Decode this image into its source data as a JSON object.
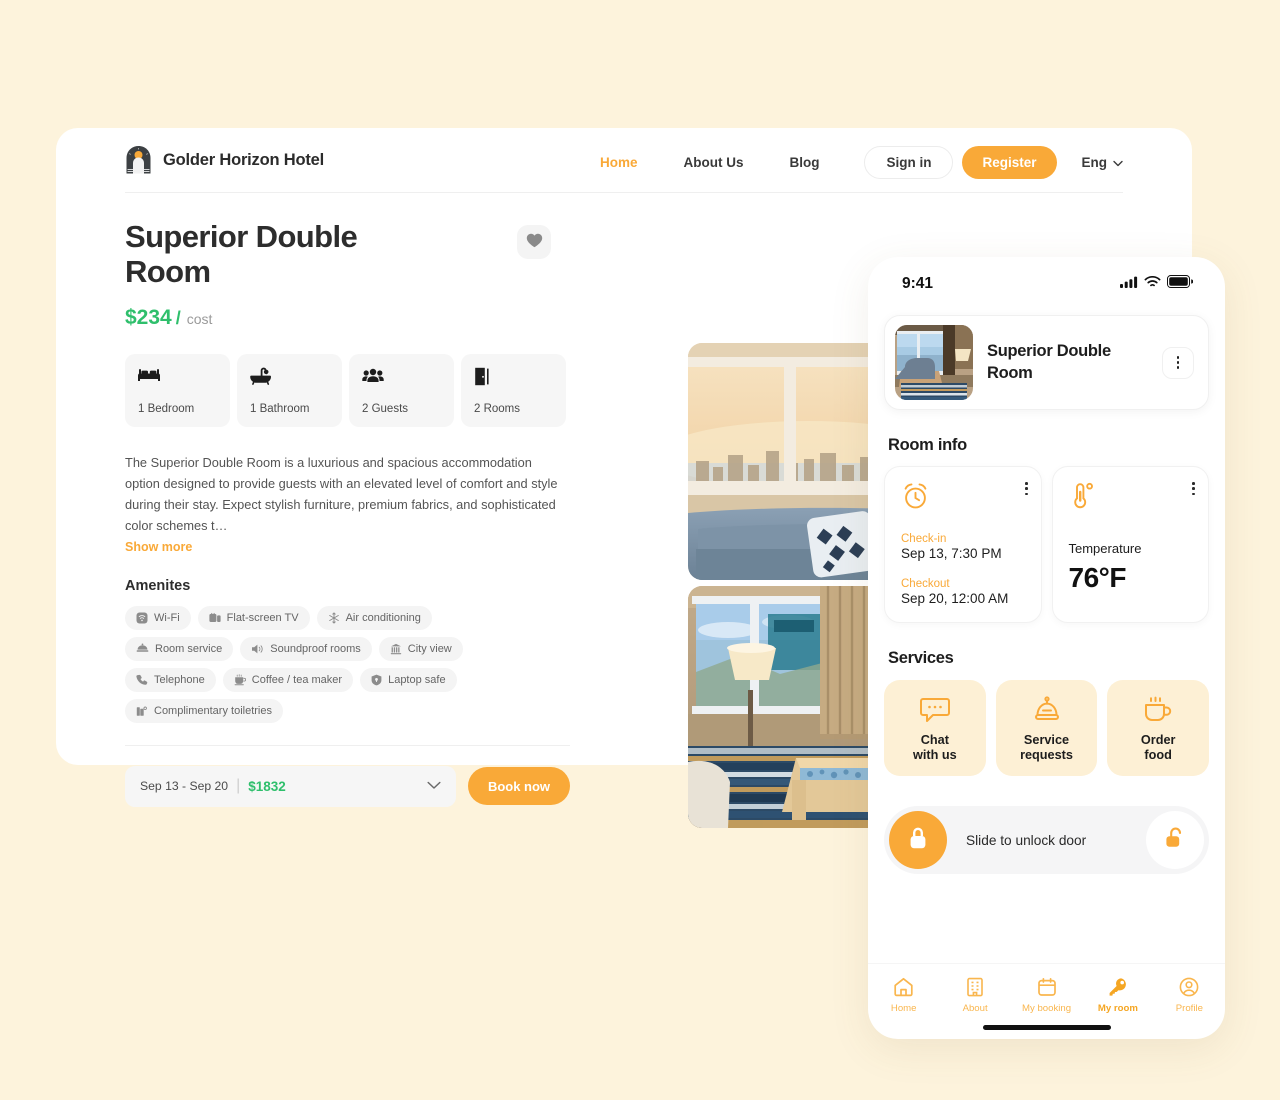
{
  "theme": {
    "page_bg": "#fdf3dc",
    "accent": "#f9a938",
    "green": "#2fbf6c",
    "text_dark": "#2d2d2d",
    "cream_card": "#fdf0d5"
  },
  "desktop": {
    "brand": {
      "name": "Golder Horizon Hotel",
      "logo_icon": "hotel-arch-logo"
    },
    "nav": [
      {
        "label": "Home",
        "active": true
      },
      {
        "label": "About Us",
        "active": false
      },
      {
        "label": "Blog",
        "active": false
      }
    ],
    "sign_in_label": "Sign in",
    "register_label": "Register",
    "language": "Eng",
    "room": {
      "title": "Superior Double Room",
      "price": "$234",
      "price_separator": "/",
      "price_unit": "cost",
      "favorite_icon": "heart-icon"
    },
    "features": [
      {
        "icon": "bed-icon",
        "label": "1 Bedroom"
      },
      {
        "icon": "bathtub-icon",
        "label": "1 Bathroom"
      },
      {
        "icon": "guests-icon",
        "label": "2 Guests"
      },
      {
        "icon": "door-icon",
        "label": "2 Rooms"
      }
    ],
    "description": "The Superior Double Room is a luxurious and spacious accommodation option designed to provide guests with an elevated level of comfort and style during their stay. Expect stylish furniture, premium fabrics, and sophisticated color schemes t…",
    "show_more_label": "Show more",
    "amenities_title": "Amenites",
    "amenities": [
      {
        "icon": "wifi-icon",
        "label": "Wi-Fi"
      },
      {
        "icon": "tv-icon",
        "label": "Flat-screen TV"
      },
      {
        "icon": "ac-icon",
        "label": "Air conditioning"
      },
      {
        "icon": "roomservice-icon",
        "label": "Room service"
      },
      {
        "icon": "soundproof-icon",
        "label": "Soundproof rooms"
      },
      {
        "icon": "cityview-icon",
        "label": "City view"
      },
      {
        "icon": "telephone-icon",
        "label": "Telephone"
      },
      {
        "icon": "coffee-icon",
        "label": "Coffee / tea maker"
      },
      {
        "icon": "safe-icon",
        "label": "Laptop safe"
      },
      {
        "icon": "toiletries-icon",
        "label": "Complimentary toiletries"
      }
    ],
    "booking": {
      "dates": "Sep 13 - Sep 20",
      "separator": "|",
      "total": "$1832",
      "chevron_icon": "chevron-down-icon",
      "book_label": "Book now"
    },
    "photos": [
      {
        "name": "hotel-room-window-sofa-sunset"
      },
      {
        "name": "hotel-room-lounge-coffee-table"
      }
    ]
  },
  "phone": {
    "status": {
      "time": "9:41",
      "signal_icon": "cellular-bars-icon",
      "wifi_icon": "wifi-icon",
      "battery_icon": "battery-full-icon"
    },
    "room_card": {
      "thumb": "room-thumbnail",
      "title": "Superior Double Room",
      "menu_icon": "kebab-menu-icon"
    },
    "room_info": {
      "title": "Room info",
      "checkin": {
        "icon": "alarm-clock-icon",
        "checkin_label": "Check-in",
        "checkin_value": "Sep 13, 7:30 PM",
        "checkout_label": "Checkout",
        "checkout_value": "Sep 20, 12:00 AM",
        "menu_icon": "kebab-menu-icon"
      },
      "temperature": {
        "icon": "thermometer-icon",
        "label": "Temperature",
        "value": "76°F",
        "menu_icon": "kebab-menu-icon"
      }
    },
    "services": {
      "title": "Services",
      "items": [
        {
          "icon": "chat-bubble-icon",
          "line1": "Chat",
          "line2": "with us"
        },
        {
          "icon": "service-bell-icon",
          "line1": "Service",
          "line2": "requests"
        },
        {
          "icon": "coffee-cup-icon",
          "line1": "Order",
          "line2": "food"
        }
      ]
    },
    "unlock": {
      "label": "Slide to unlock door",
      "knob_icon": "lock-closed-icon",
      "target_icon": "lock-open-icon"
    },
    "tabs": [
      {
        "icon": "home-icon",
        "label": "Home",
        "active": false
      },
      {
        "icon": "building-icon",
        "label": "About",
        "active": false
      },
      {
        "icon": "calendar-icon",
        "label": "My booking",
        "active": false
      },
      {
        "icon": "key-icon",
        "label": "My room",
        "active": true
      },
      {
        "icon": "profile-icon",
        "label": "Profile",
        "active": false
      }
    ]
  }
}
